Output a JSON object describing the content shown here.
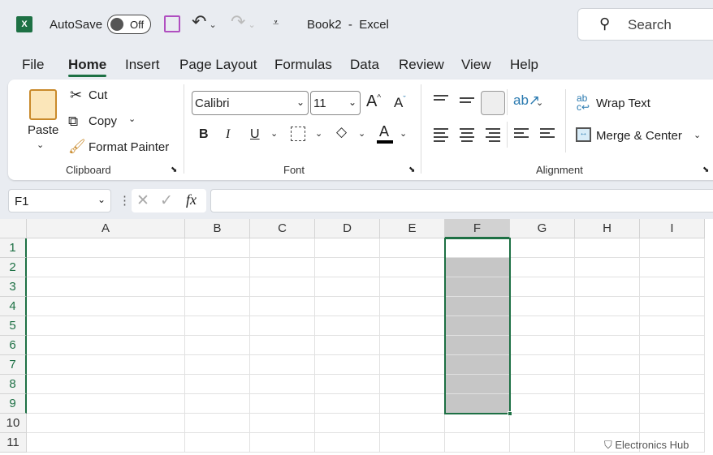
{
  "titlebar": {
    "app_icon": "X",
    "autosave_label": "AutoSave",
    "autosave_state": "Off",
    "document_title": "Book2  -  Excel",
    "search_placeholder": "Search"
  },
  "tabs": [
    {
      "label": "File"
    },
    {
      "label": "Home",
      "active": true
    },
    {
      "label": "Insert"
    },
    {
      "label": "Page Layout"
    },
    {
      "label": "Formulas"
    },
    {
      "label": "Data"
    },
    {
      "label": "Review"
    },
    {
      "label": "View"
    },
    {
      "label": "Help"
    }
  ],
  "clipboard": {
    "paste": "Paste",
    "cut": "Cut",
    "copy": "Copy",
    "format_painter": "Format Painter",
    "group": "Clipboard"
  },
  "font": {
    "name": "Calibri",
    "size": "11",
    "bold": "B",
    "italic": "I",
    "underline": "U",
    "grow": "A",
    "shrink": "A",
    "color_letter": "A",
    "group": "Font",
    "font_color": "#000000"
  },
  "alignment": {
    "wrap_text": "Wrap Text",
    "merge_center": "Merge & Center",
    "group": "Alignment"
  },
  "formula_bar": {
    "name_box": "F1",
    "fx": "fx",
    "value": ""
  },
  "grid": {
    "columns": [
      "A",
      "B",
      "C",
      "D",
      "E",
      "F",
      "G",
      "H",
      "I"
    ],
    "rows": [
      "1",
      "2",
      "3",
      "4",
      "5",
      "6",
      "7",
      "8",
      "9",
      "10",
      "11"
    ],
    "selected_column": "F",
    "selection": "F1:F9",
    "active_cell": "F1"
  },
  "watermark": "Electronics Hub",
  "colors": {
    "accent": "#1d7044",
    "selection_fill": "#c6c6c6"
  }
}
